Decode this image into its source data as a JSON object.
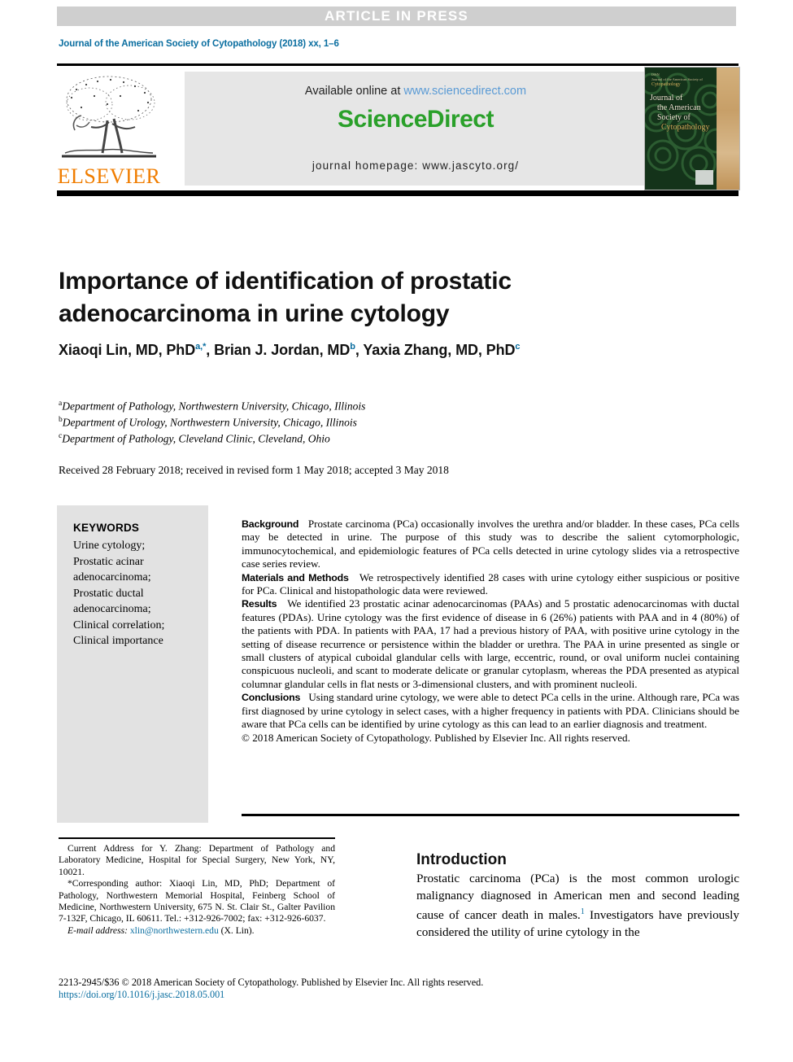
{
  "banner": {
    "text": "ARTICLE IN PRESS"
  },
  "journal_citation": {
    "text": "Journal of the American Society of Cytopathology (2018) xx, 1–6"
  },
  "masthead": {
    "available_prefix": "Available online at ",
    "sciencedirect_url": "www.sciencedirect.com",
    "sciencedirect_logo": "ScienceDirect",
    "homepage": "journal homepage: www.jascyto.org/",
    "publisher": "ELSEVIER",
    "publisher_icon": "elsevier-tree-logo",
    "cover": {
      "top_line_1": "ISSN",
      "top_line_2": "Journal of the American Society of",
      "top_line_3": "Cytopathology",
      "line1": "Journal of",
      "line2": "the American",
      "line3": "Society of",
      "line4": "Cytopathology"
    }
  },
  "article": {
    "title": "Importance of identification of prostatic adenocarcinoma in urine cytology",
    "authors": [
      {
        "name": "Xiaoqi Lin, MD, PhD",
        "sup": "a",
        "star": "*",
        "sep": ", "
      },
      {
        "name": "Brian J. Jordan, MD",
        "sup": "b",
        "star": "",
        "sep": ", "
      },
      {
        "name": "Yaxia Zhang, MD, PhD",
        "sup": "c",
        "star": "",
        "sep": ""
      }
    ],
    "affiliations": [
      {
        "marker": "a",
        "text": "Department of Pathology, Northwestern University, Chicago, Illinois"
      },
      {
        "marker": "b",
        "text": "Department of Urology, Northwestern University, Chicago, Illinois"
      },
      {
        "marker": "c",
        "text": "Department of Pathology, Cleveland Clinic, Cleveland, Ohio"
      }
    ],
    "received": "Received 28 February 2018; received in revised form 1 May 2018; accepted 3 May 2018"
  },
  "keywords": {
    "heading": "KEYWORDS",
    "items": [
      "Urine cytology;",
      "Prostatic acinar",
      "adenocarcinoma;",
      "Prostatic ductal",
      "adenocarcinoma;",
      "Clinical correlation;",
      "Clinical importance"
    ]
  },
  "abstract": {
    "sections": [
      {
        "label": "Background",
        "body": "Prostate carcinoma (PCa) occasionally involves the urethra and/or bladder. In these cases, PCa cells may be detected in urine. The purpose of this study was to describe the salient cytomorphologic, immunocytochemical, and epidemiologic features of PCa cells detected in urine cytology slides via a retrospective case series review."
      },
      {
        "label": "Materials and Methods",
        "body": "We retrospectively identified 28 cases with urine cytology either suspicious or positive for PCa. Clinical and histopathologic data were reviewed."
      },
      {
        "label": "Results",
        "body": "We identified 23 prostatic acinar adenocarcinomas (PAAs) and 5 prostatic adenocarcinomas with ductal features (PDAs). Urine cytology was the first evidence of disease in 6 (26%) patients with PAA and in 4 (80%) of the patients with PDA. In patients with PAA, 17 had a previous history of PAA, with positive urine cytology in the setting of disease recurrence or persistence within the bladder or urethra. The PAA in urine presented as single or small clusters of atypical cuboidal glandular cells with large, eccentric, round, or oval uniform nuclei containing conspicuous nucleoli, and scant to moderate delicate or granular cytoplasm, whereas the PDA presented as atypical columnar glandular cells in flat nests or 3-dimensional clusters, and with prominent nucleoli."
      },
      {
        "label": "Conclusions",
        "body": "Using standard urine cytology, we were able to detect PCa cells in the urine. Although rare, PCa was first diagnosed by urine cytology in select cases, with a higher frequency in patients with PDA. Clinicians should be aware that PCa cells can be identified by urine cytology as this can lead to an earlier diagnosis and treatment."
      }
    ],
    "copyright": "© 2018 American Society of Cytopathology. Published by Elsevier Inc. All rights reserved."
  },
  "footnotes": {
    "current_address": "Current Address for Y. Zhang: Department of Pathology and Laboratory Medicine, Hospital for Special Surgery, New York, NY, 10021.",
    "corresponding": "*Corresponding author: Xiaoqi Lin, MD, PhD; Department of Pathology, Northwestern Memorial Hospital, Feinberg School of Medicine, Northwestern University, 675 N. St. Clair St., Galter Pavilion 7-132F, Chicago, IL 60611. Tel.: +312-926-7002; fax: +312-926-6037.",
    "email_label": "E-mail address:",
    "email": "xlin@northwestern.edu",
    "email_suffix": " (X. Lin)."
  },
  "introduction": {
    "heading": "Introduction",
    "paragraph_part1": "Prostatic carcinoma (PCa) is the most common urologic malignancy diagnosed in American men and second leading cause of cancer death in males.",
    "reference_marker": "1",
    "paragraph_part2": " Investigators have previously considered the utility of urine cytology in the"
  },
  "footer": {
    "issn_line": "2213-2945/$36 © 2018 American Society of Cytopathology. Published by Elsevier Inc. All rights reserved.",
    "doi": "https://doi.org/10.1016/j.jasc.2018.05.001"
  },
  "colors": {
    "link_blue": "#0a6ea0",
    "sciencedirect_green": "#2aa02a",
    "sciencedirect_url_blue": "#5b9bd5",
    "elsevier_orange": "#F07D00",
    "banner_gray": "#cfcfcf",
    "panel_gray": "#e6e6e6",
    "keyword_box_gray": "#e2e2e2"
  }
}
